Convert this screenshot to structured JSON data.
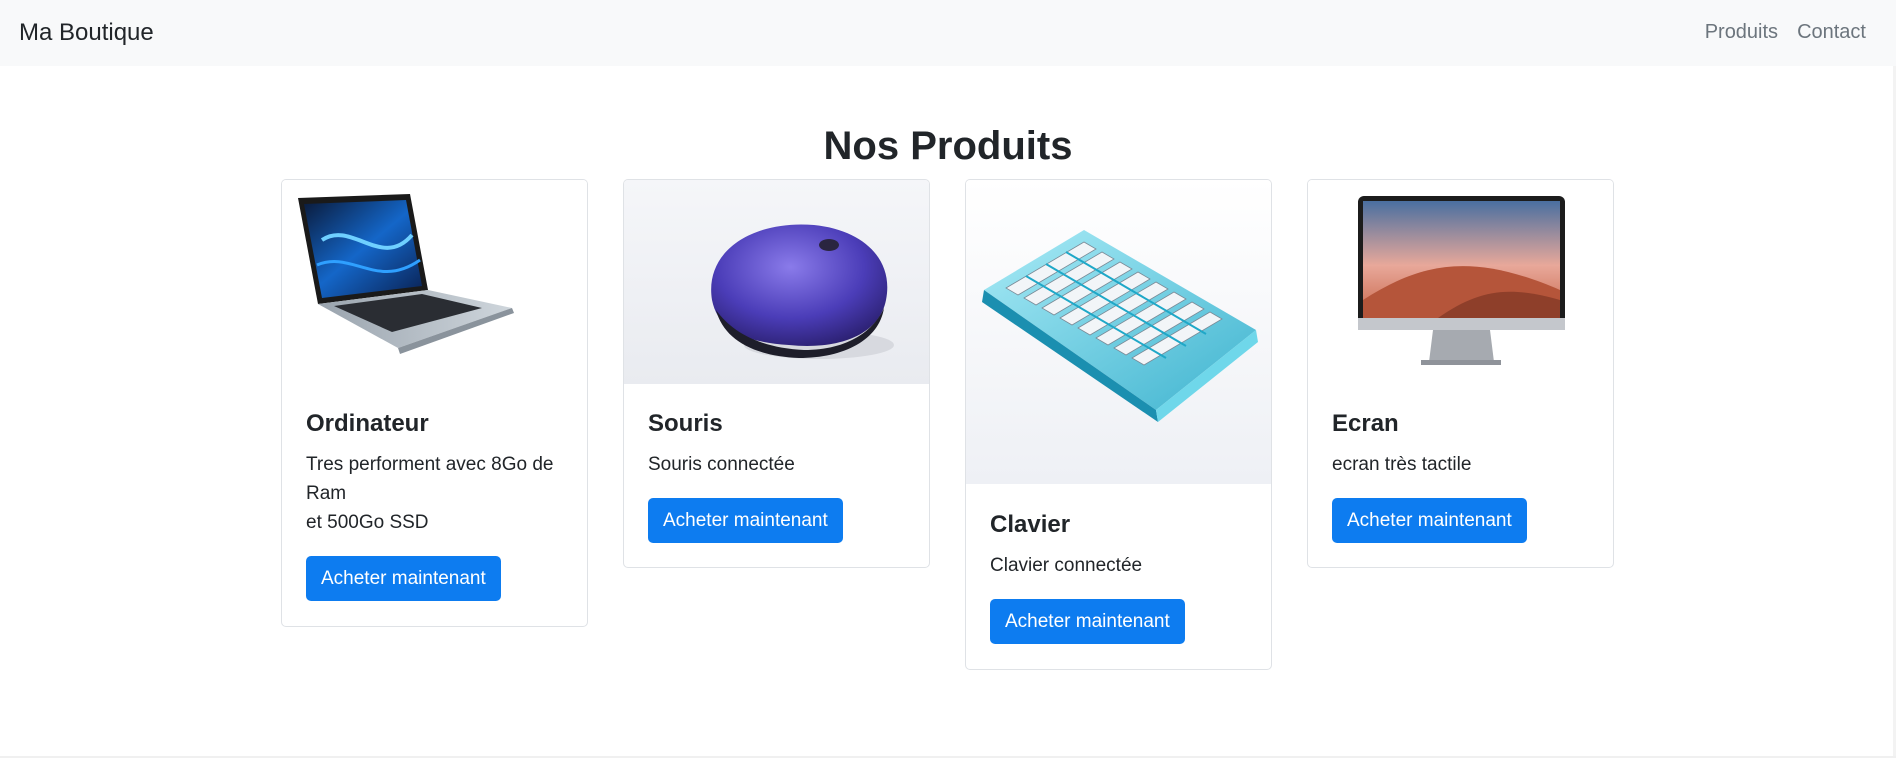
{
  "navbar": {
    "brand": "Ma Boutique",
    "links": [
      "Produits",
      "Contact"
    ]
  },
  "main": {
    "title": "Nos Produits",
    "products": [
      {
        "name": "Ordinateur",
        "description_line1": "Tres performent avec 8Go de Ram",
        "description_line2": "et 500Go SSD",
        "button": "Acheter maintenant",
        "image_icon": "laptop-icon"
      },
      {
        "name": "Souris",
        "description_line1": "Souris connectée",
        "button": "Acheter maintenant",
        "image_icon": "mouse-icon"
      },
      {
        "name": "Clavier",
        "description_line1": "Clavier connectée",
        "button": "Acheter maintenant",
        "image_icon": "keyboard-icon"
      },
      {
        "name": "Ecran",
        "description_line1": "ecran très tactile",
        "button": "Acheter maintenant",
        "image_icon": "monitor-icon"
      }
    ]
  },
  "colors": {
    "navbar_bg": "#f8f9fa",
    "primary_button": "#0d7cf0",
    "nav_link": "#6c757d",
    "text": "#212529"
  }
}
